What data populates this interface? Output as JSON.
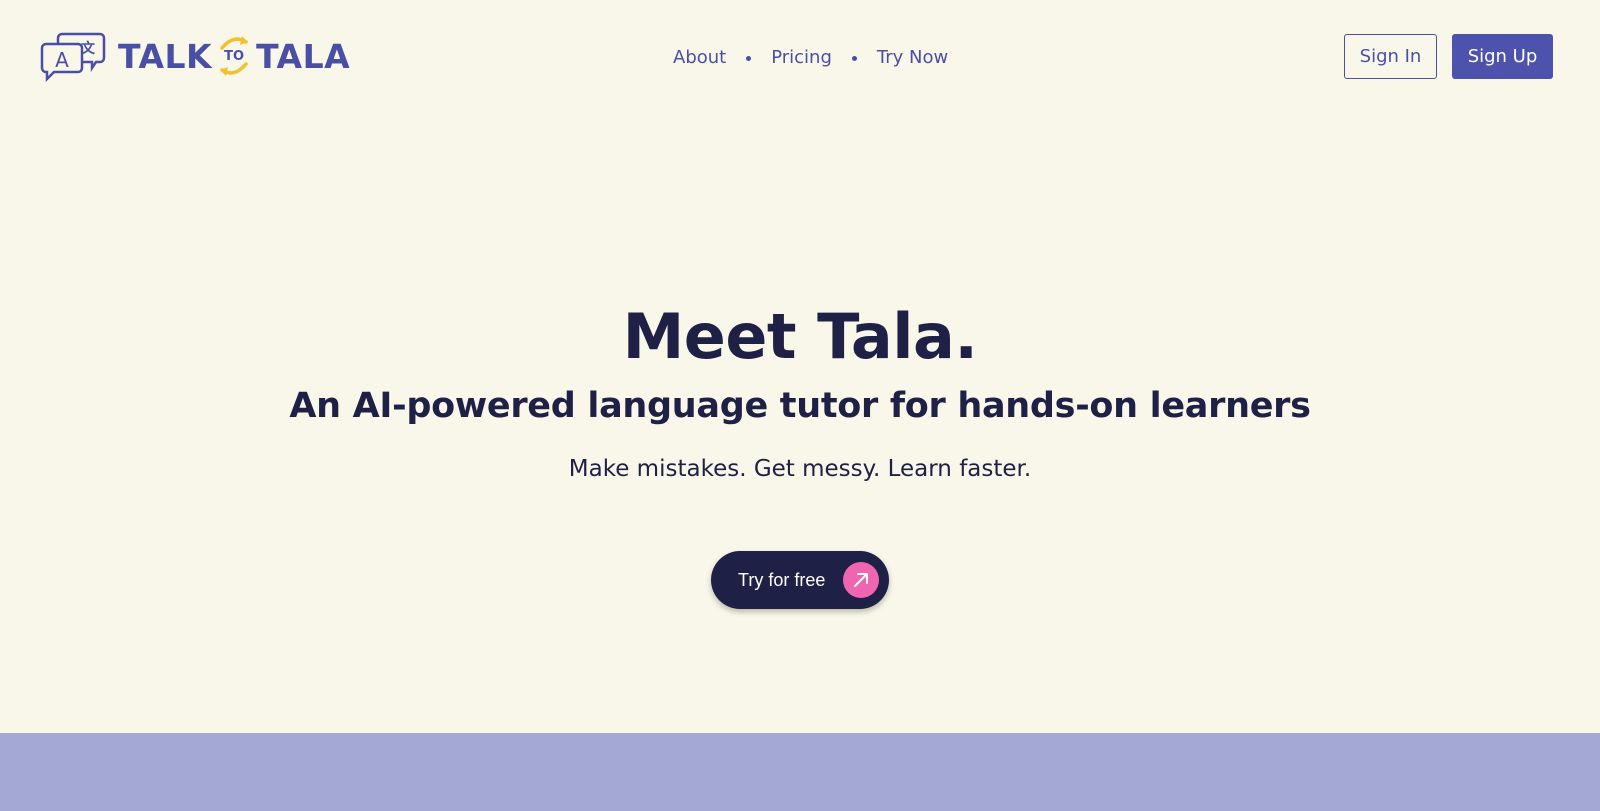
{
  "brand": {
    "word1": "TALK",
    "connector": "TO",
    "word2": "TALA",
    "icon": "translate-chat-bubbles-icon",
    "color": "#4a4fa6",
    "accent": "#f2c12e"
  },
  "nav": {
    "links": [
      "About",
      "Pricing",
      "Try Now"
    ],
    "sign_in": "Sign In",
    "sign_up": "Sign Up"
  },
  "hero": {
    "title": "Meet Tala.",
    "subtitle": "An AI-powered language tutor for hands-on learners",
    "tagline": "Make mistakes. Get messy. Learn faster.",
    "cta_label": "Try for free",
    "cta_icon": "arrow-up-right-icon"
  },
  "colors": {
    "background": "#f9f7e9",
    "primary": "#4d53ad",
    "dark": "#1f2045",
    "cta_accent": "#f065b0",
    "band": "#a3a8d5"
  }
}
